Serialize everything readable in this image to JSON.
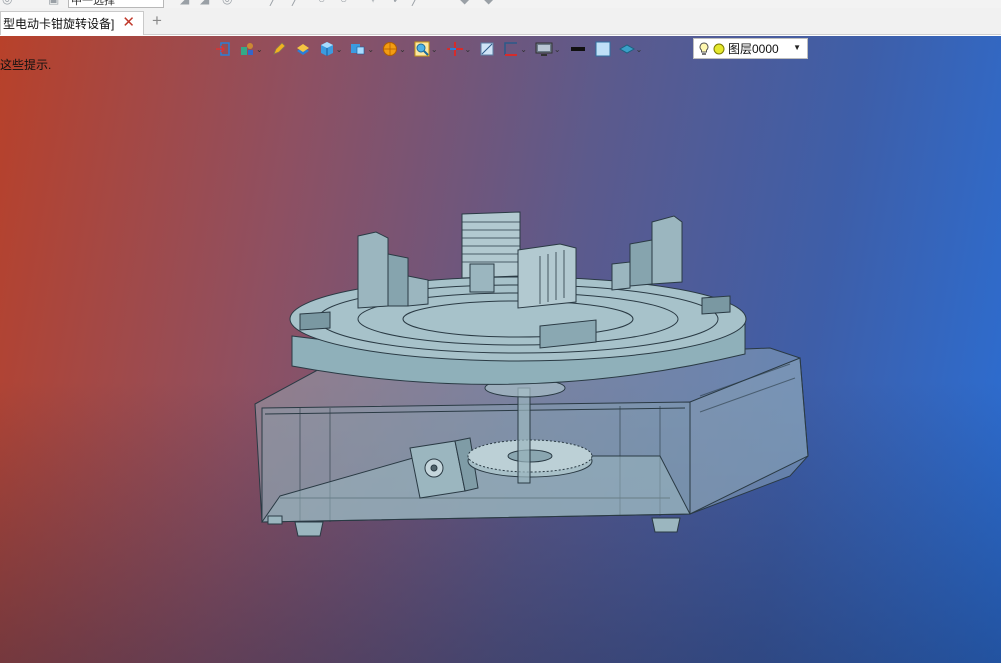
{
  "toolbar_top": {
    "selection_mode": "中一选择"
  },
  "tabs": [
    {
      "label": "型电动卡钳旋转设备]"
    }
  ],
  "tab_add_label": "+",
  "viewport": {
    "hint_text": "这些提示."
  },
  "layer_selector": {
    "value": "图层0000"
  },
  "colors": {
    "bg_left": "#b8412a",
    "bg_right": "#2a6fd6",
    "model_fill": "#9bb6bf",
    "model_stroke": "#2a3a44"
  }
}
